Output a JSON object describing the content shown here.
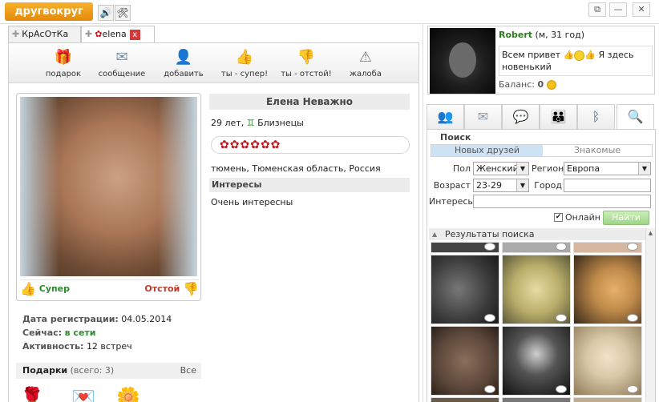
{
  "app": {
    "logo_text": "другвокруг",
    "accent": "#f0a21f"
  },
  "window": {
    "buttons": [
      "restore-icon",
      "minimize-icon",
      "close-icon"
    ],
    "restore": "⧉",
    "minimize": "—",
    "close": "✕"
  },
  "topbar": {
    "sound": "🔊",
    "tools": "🛠"
  },
  "tabs": [
    {
      "label": "КрАсОтКа",
      "active": false
    },
    {
      "label": "elena",
      "active": true
    }
  ],
  "tab_close": "x",
  "toolbar": {
    "gift": "подарок",
    "message": "сообщение",
    "add": "добавить",
    "like": "ты - супер!",
    "dislike": "ты - отстой!",
    "complaint": "жалоба"
  },
  "profile": {
    "name": "Елена Неважно",
    "age_sign": "29 лет,",
    "zodiac": "Близнецы",
    "rose_count": 6,
    "location": "тюмень, Тюменская область, Россия",
    "interests_title": "Интересы",
    "interests": "Очень интересны",
    "vote_good": "Супер",
    "vote_bad": "Отстой",
    "reg_label": "Дата регистрации:",
    "reg_value": "04.05.2014",
    "now_label": "Сейчас:",
    "now_value": "в сети",
    "activity_label": "Активность:",
    "activity_value": "12 встреч",
    "gifts_label": "Подарки",
    "gifts_count": "(всего: 3)",
    "gifts_all": "Все"
  },
  "me": {
    "name": "Robert",
    "meta": "(м, 31 год)",
    "status_1": "Всем привет",
    "status_2": "Я здесь",
    "status_3": "новенький",
    "balance_label": "Баланс:",
    "balance_value": "0"
  },
  "right_tabs": [
    "people-icon",
    "mail-icon",
    "chat-icon",
    "group-icon",
    "bluetooth-icon",
    "search-icon"
  ],
  "search": {
    "title": "Поиск",
    "tab_new_friends": "Новых друзей",
    "tab_acquaintances": "Знакомые",
    "gender_label": "Пол",
    "gender_value": "Женский",
    "region_label": "Регион",
    "region_value": "Европа",
    "age_label": "Возраст",
    "age_value": "23-29",
    "city_label": "Город",
    "city_value": "",
    "interests_label": "Интересы",
    "interests_value": "",
    "online_label": "Онлайн",
    "online_checked": true,
    "find_button": "Найти",
    "results_title": "Результаты поиска"
  },
  "result_thumbs": [
    {
      "color": "#3a3a3a"
    },
    {
      "color": "#b9ad6a"
    },
    {
      "color": "#c08a4a"
    },
    {
      "color": "#5a463a"
    },
    {
      "color": "#2a2a2a"
    },
    {
      "color": "#d8c9a8"
    }
  ]
}
